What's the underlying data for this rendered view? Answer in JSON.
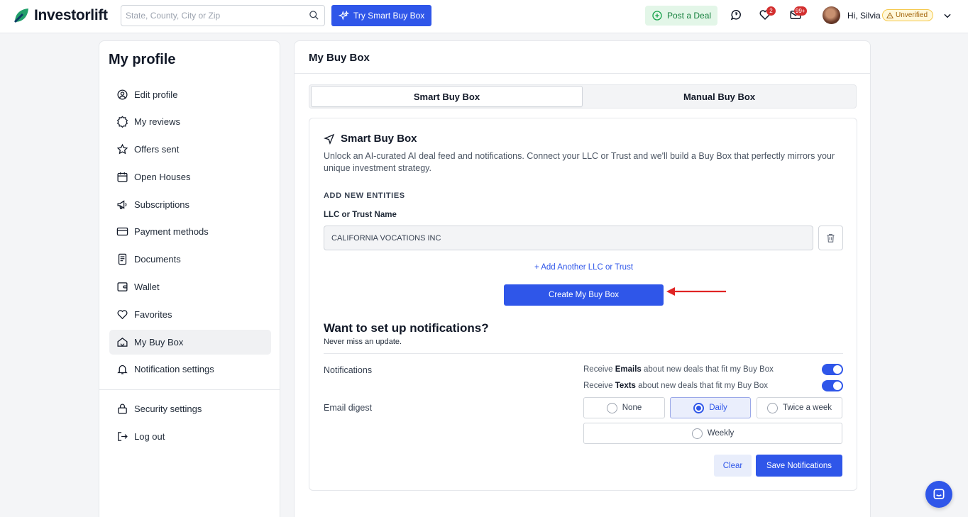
{
  "header": {
    "logo_text": "Investorlift",
    "search_placeholder": "State, County, City or Zip",
    "try_button": "Try Smart Buy Box",
    "post_deal": "Post a Deal",
    "favorites_badge": "2",
    "messages_badge": "99+",
    "greeting": "Hi, Silvia",
    "status": "Unverified"
  },
  "sidebar": {
    "title": "My profile",
    "items": [
      {
        "label": "Edit profile",
        "icon": "user-circle-icon"
      },
      {
        "label": "My reviews",
        "icon": "badge-icon"
      },
      {
        "label": "Offers sent",
        "icon": "star-icon"
      },
      {
        "label": "Open Houses",
        "icon": "calendar-icon"
      },
      {
        "label": "Subscriptions",
        "icon": "megaphone-icon"
      },
      {
        "label": "Payment methods",
        "icon": "credit-card-icon"
      },
      {
        "label": "Documents",
        "icon": "document-icon"
      },
      {
        "label": "Wallet",
        "icon": "wallet-icon"
      },
      {
        "label": "Favorites",
        "icon": "heart-icon"
      },
      {
        "label": "My Buy Box",
        "icon": "home-icon"
      },
      {
        "label": "Notification settings",
        "icon": "bell-icon"
      }
    ],
    "bottom_items": [
      {
        "label": "Security settings",
        "icon": "lock-icon"
      },
      {
        "label": "Log out",
        "icon": "logout-icon"
      }
    ]
  },
  "main": {
    "title": "My Buy Box",
    "tabs": [
      "Smart Buy Box",
      "Manual Buy Box"
    ],
    "card": {
      "title": "Smart Buy Box",
      "description": "Unlock an AI-curated AI deal feed and notifications. Connect your LLC or Trust and we'll build a Buy Box that perfectly mirrors your unique investment strategy.",
      "section_label": "ADD NEW ENTITIES",
      "field_label": "LLC or Trust Name",
      "field_value": "CALIFORNIA VOCATIONS INC",
      "add_link": "+ Add Another LLC or Trust",
      "create_button": "Create My Buy Box"
    },
    "notifications": {
      "title": "Want to set up notifications?",
      "subtitle": "Never miss an update.",
      "label": "Notifications",
      "email_option": {
        "pre": "Receive ",
        "bold": "Emails",
        "post": " about new deals that fit my Buy Box"
      },
      "text_option": {
        "pre": "Receive ",
        "bold": "Texts",
        "post": " about new deals that fit my Buy Box"
      },
      "digest_label": "Email digest",
      "digest_options": [
        "None",
        "Daily",
        "Twice a week",
        "Weekly"
      ],
      "digest_selected": "Daily",
      "clear_button": "Clear",
      "save_button": "Save Notifications"
    }
  },
  "colors": {
    "accent": "#2f56e9",
    "success_bg": "#e3f6e8",
    "badge": "#d32f2f"
  }
}
